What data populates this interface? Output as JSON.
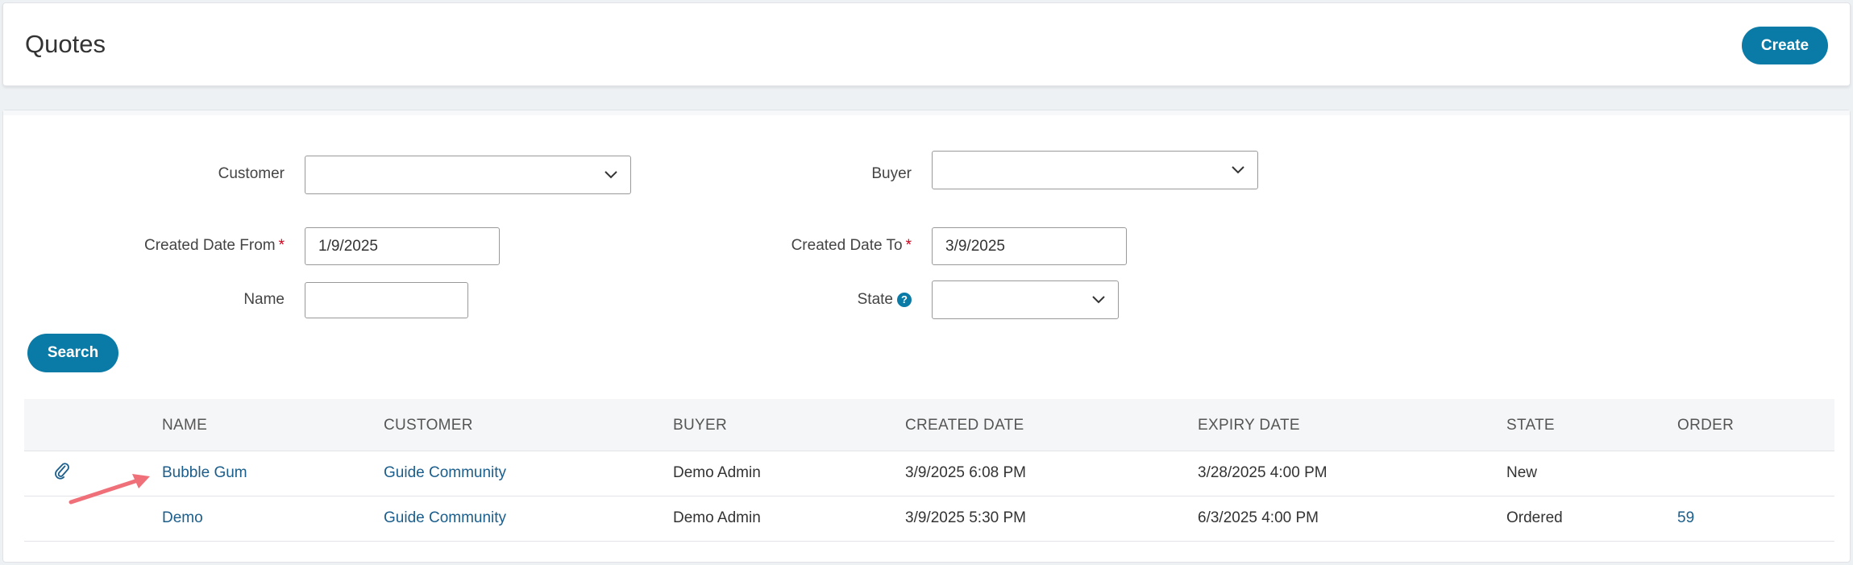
{
  "header": {
    "title": "Quotes",
    "create_label": "Create"
  },
  "filters": {
    "customer_label": "Customer",
    "customer_value": "",
    "buyer_label": "Buyer",
    "buyer_value": "",
    "created_from_label": "Created Date From",
    "created_from_value": "1/9/2025",
    "created_to_label": "Created Date To",
    "created_to_value": "3/9/2025",
    "name_label": "Name",
    "name_value": "",
    "state_label": "State",
    "state_value": "",
    "required_mark": "*",
    "help_glyph": "?",
    "search_label": "Search"
  },
  "table": {
    "columns": [
      "NAME",
      "CUSTOMER",
      "BUYER",
      "CREATED DATE",
      "EXPIRY DATE",
      "STATE",
      "ORDER"
    ],
    "rows": [
      {
        "has_attachment": true,
        "name": "Bubble Gum",
        "customer": "Guide Community",
        "buyer": "Demo Admin",
        "created": "3/9/2025 6:08 PM",
        "expiry": "3/28/2025 4:00 PM",
        "state": "New",
        "order": ""
      },
      {
        "has_attachment": false,
        "name": "Demo",
        "customer": "Guide Community",
        "buyer": "Demo Admin",
        "created": "3/9/2025 5:30 PM",
        "expiry": "6/3/2025 4:00 PM",
        "state": "Ordered",
        "order": "59"
      }
    ]
  },
  "colors": {
    "primary": "#0a7aa6",
    "link": "#1b5e8c",
    "required": "#d0021b",
    "annotation_arrow": "#f0707a"
  },
  "icons": {
    "attachment": "paperclip-icon",
    "dropdown": "chevron-down-icon",
    "help": "question-circle-icon",
    "annotation": "arrow-annotation-icon"
  }
}
